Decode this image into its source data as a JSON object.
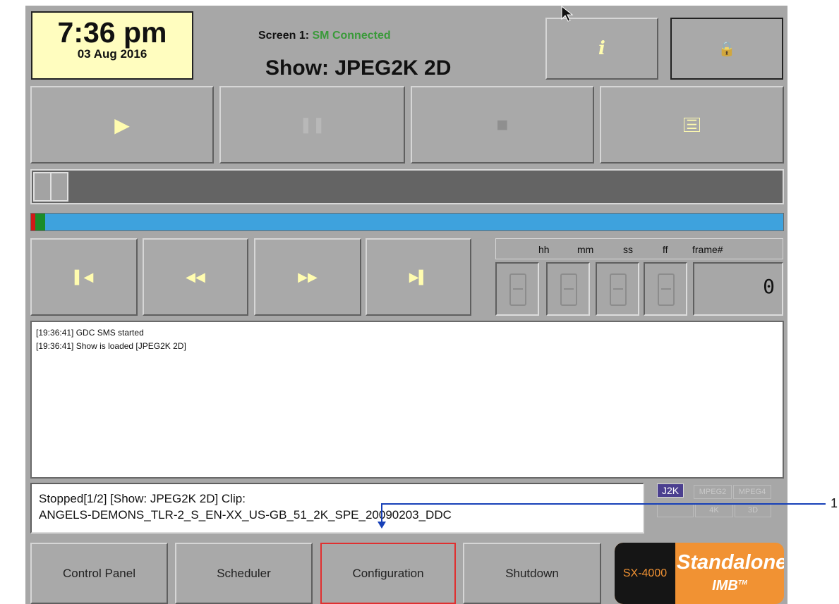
{
  "clock": {
    "time": "7:36 pm",
    "date": "03 Aug 2016"
  },
  "screen": {
    "label": "Screen 1:",
    "status": "SM Connected",
    "show": "Show: JPEG2K 2D"
  },
  "info_button": {
    "icon": "info-icon",
    "glyph": "i"
  },
  "lock_button": {
    "icon": "lock-icon",
    "glyph": "🔒"
  },
  "transport": {
    "play": {
      "icon": "play-icon",
      "glyph": "▶"
    },
    "pause": {
      "icon": "pause-icon",
      "glyph": "❚❚"
    },
    "stop": {
      "icon": "stop-icon",
      "glyph": "■"
    },
    "playlist": {
      "icon": "playlist-icon",
      "glyph": "☰"
    }
  },
  "navigation": {
    "skip_start": {
      "icon": "skip-to-start-icon",
      "glyph": "▌◀"
    },
    "rewind": {
      "icon": "rewind-icon",
      "glyph": "◀◀"
    },
    "fast_forward": {
      "icon": "fast-forward-icon",
      "glyph": "▶▶"
    },
    "skip_end": {
      "icon": "skip-to-end-icon",
      "glyph": "▶▌"
    }
  },
  "timecode": {
    "headers": [
      "hh",
      "mm",
      "ss",
      "ff",
      "frame#"
    ],
    "frame_value": "0"
  },
  "progress": {
    "played_fraction": 0.02
  },
  "log": {
    "lines": [
      "[19:36:41] GDC SMS started",
      "[19:36:41] Show is loaded [JPEG2K 2D]"
    ]
  },
  "status": {
    "line1": "Stopped[1/2] [Show: JPEG2K 2D] Clip:",
    "line2": "ANGELS-DEMONS_TLR-2_S_EN-XX_US-GB_51_2K_SPE_20090203_DDC"
  },
  "codecs": {
    "row1": [
      "J2K",
      "MPEG2",
      "MPEG4"
    ],
    "row2": [
      "",
      "4K",
      "3D"
    ],
    "active": "J2K"
  },
  "bottom_nav": [
    "Control Panel",
    "Scheduler",
    "Configuration",
    "Shutdown"
  ],
  "brand": {
    "model": "SX-4000",
    "line1": "Standalone",
    "line2": "IMB",
    "tm": "TM"
  },
  "callout": {
    "number": "1"
  },
  "colors": {
    "panel": "#a7a7a7",
    "clock_bg": "#fffdbf",
    "progress": "#3ea2dd",
    "accent": "#4b3f8f",
    "brand": "#f19233",
    "connected": "#3a9a3a"
  }
}
